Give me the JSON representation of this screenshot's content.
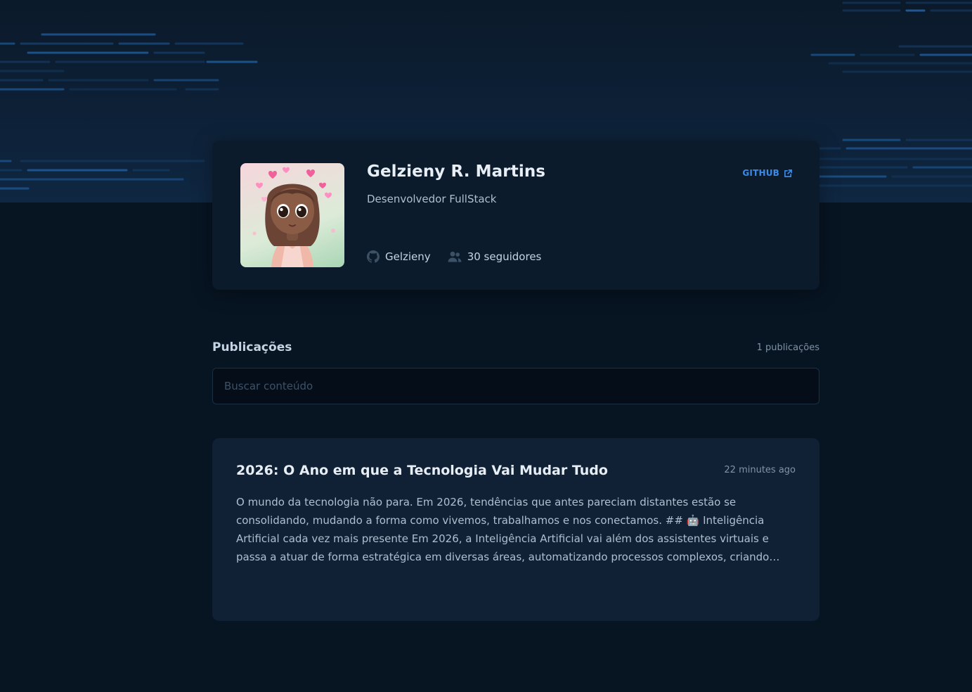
{
  "profile": {
    "name": "Gelzieny R. Martins",
    "role": "Desenvolvedor FullStack",
    "github_label": "GITHUB",
    "username": "Gelzieny",
    "followers": "30 seguidores"
  },
  "publications": {
    "title": "Publicações",
    "count": "1 publicações",
    "search_placeholder": "Buscar conteúdo"
  },
  "posts": [
    {
      "title": "2026: O Ano em que a Tecnologia Vai Mudar Tudo",
      "time": "22 minutes ago",
      "excerpt": "O mundo da tecnologia não para. Em 2026, tendências que antes pareciam distantes estão se consolidando, mudando a forma como vivemos, trabalhamos e nos conectamos. ## 🤖 Inteligência Artificial cada vez mais presente Em 2026, a Inteligência Artificial vai além dos assistentes virtuais e passa a atuar de forma estratégica em diversas áreas, automatizando processos complexos, criando conteúdo e apoiando decisões..."
    }
  ],
  "icons": {
    "github": "github-icon",
    "followers": "users-icon",
    "external_link": "external-link-icon"
  },
  "colors": {
    "accent": "#3a8ae8",
    "background": "#071422",
    "card": "#0b1b2c",
    "post_card": "#112135"
  }
}
